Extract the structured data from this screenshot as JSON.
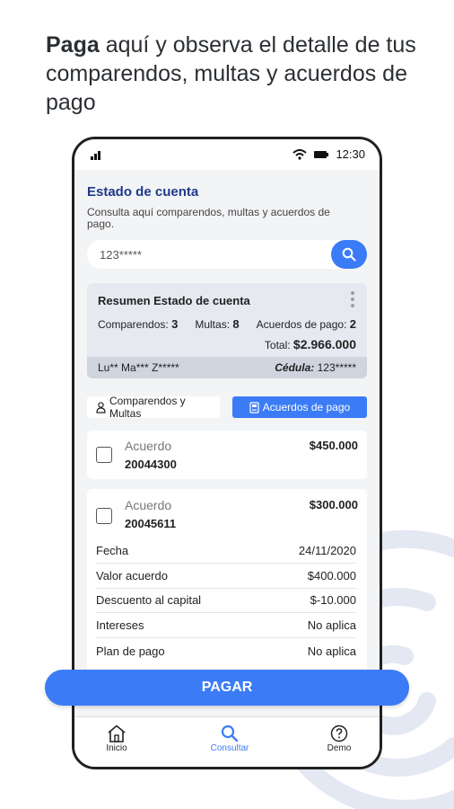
{
  "headline": {
    "bold": "Paga",
    "rest": " aquí y observa el detalle de tus comparendos, multas y acuerdos de pago"
  },
  "status_bar": {
    "time": "12:30"
  },
  "screen": {
    "title": "Estado de cuenta",
    "subtitle": "Consulta aquí comparendos, multas y acuerdos de pago.",
    "search": {
      "value": "123*****"
    },
    "summary": {
      "title": "Resumen Estado de cuenta",
      "comparendos_label": "Comparendos:",
      "comparendos_value": "3",
      "multas_label": "Multas:",
      "multas_value": "8",
      "acuerdos_label": "Acuerdos de pago:",
      "acuerdos_value": "2",
      "total_label": "Total:",
      "total_value": "$2.966.000",
      "name": "Lu** Ma*** Z*****",
      "cedula_label": "Cédula:",
      "cedula_value": "123*****"
    },
    "tabs": {
      "comparendos": "Comparendos y Multas",
      "acuerdos": "Acuerdos de pago"
    },
    "agreements": [
      {
        "label": "Acuerdo",
        "number": "20044300",
        "amount": "$450.000"
      },
      {
        "label": "Acuerdo",
        "number": "20045611",
        "amount": "$300.000",
        "details": [
          {
            "label": "Fecha",
            "value": "24/11/2020"
          },
          {
            "label": "Valor acuerdo",
            "value": "$400.000"
          },
          {
            "label": "Descuento al capital",
            "value": "$-10.000"
          },
          {
            "label": "Intereses",
            "value": "No aplica"
          },
          {
            "label": "Plan de pago",
            "value": "No aplica"
          }
        ]
      }
    ]
  },
  "pay_button": "PAGAR",
  "nav": {
    "home": "Inicio",
    "search": "Consultar",
    "demo": "Demo"
  },
  "colors": {
    "accent": "#3b7cf6",
    "title": "#1d3a8a",
    "swirl": "#e4e8f3"
  },
  "icons": {
    "signal": "signal-icon",
    "wifi": "wifi-icon",
    "battery": "battery-icon",
    "search": "search-icon",
    "more": "more-vert-icon",
    "person_id": "person-badge-icon",
    "agreement": "document-icon",
    "home": "home-icon",
    "consult": "search-icon",
    "help": "help-icon"
  }
}
